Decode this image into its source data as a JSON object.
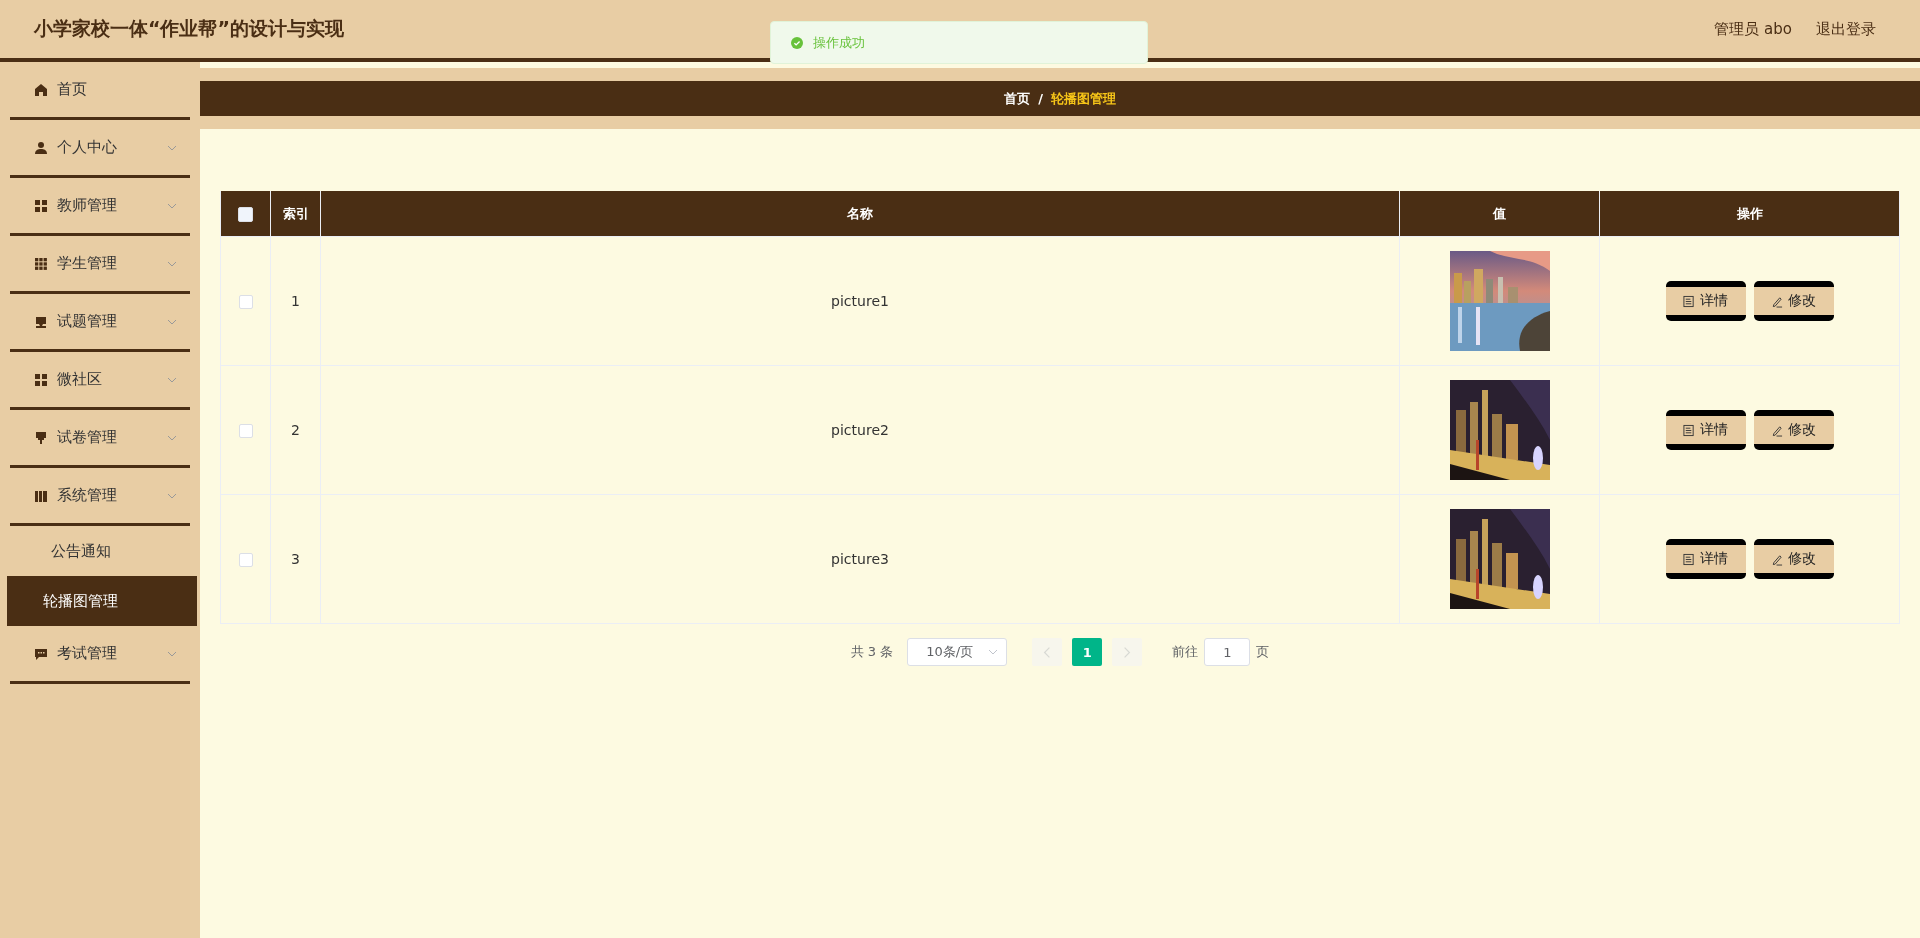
{
  "header": {
    "title": "小学家校一体“作业帮”的设计与实现",
    "user": "管理员 abo",
    "logout": "退出登录"
  },
  "toast": {
    "kind": "success",
    "message": "操作成功"
  },
  "sidebar": {
    "items": [
      {
        "label": "首页",
        "kind": "link"
      },
      {
        "label": "个人中心",
        "kind": "submenu"
      },
      {
        "label": "教师管理",
        "kind": "submenu"
      },
      {
        "label": "学生管理",
        "kind": "submenu"
      },
      {
        "label": "试题管理",
        "kind": "submenu"
      },
      {
        "label": "微社区",
        "kind": "submenu"
      },
      {
        "label": "试卷管理",
        "kind": "submenu"
      },
      {
        "label": "系统管理",
        "kind": "submenu",
        "children": [
          {
            "label": "公告通知",
            "selected": false
          },
          {
            "label": "轮播图管理",
            "selected": true
          }
        ]
      },
      {
        "label": "考试管理",
        "kind": "submenu"
      }
    ]
  },
  "breadcrumb": [
    {
      "label": "首页",
      "current": false
    },
    {
      "label": "轮播图管理",
      "current": true
    }
  ],
  "breadcrumb_separator": "/",
  "table": {
    "select_all_checked": false,
    "columns": [
      "索引",
      "名称",
      "值",
      "操作"
    ],
    "rows": [
      {
        "checked": false,
        "index": "1",
        "name": "picture1",
        "value": {
          "kind": "picture"
        },
        "actions": [
          "详情",
          "修改"
        ]
      },
      {
        "checked": false,
        "index": "2",
        "name": "picture2",
        "value": {
          "kind": "picture"
        },
        "actions": [
          "详情",
          "修改"
        ]
      },
      {
        "checked": false,
        "index": "3",
        "name": "picture3",
        "value": {
          "kind": "picture"
        },
        "actions": [
          "详情",
          "修改"
        ]
      }
    ]
  },
  "pagination": {
    "total": "共 3 条",
    "page_size": "10条/页",
    "pages": [
      {
        "label": "1",
        "selected": true
      }
    ],
    "prev_disabled": true,
    "next_disabled": true,
    "goto_label": "前往",
    "goto_value": "1",
    "goto_suffix": "页"
  }
}
